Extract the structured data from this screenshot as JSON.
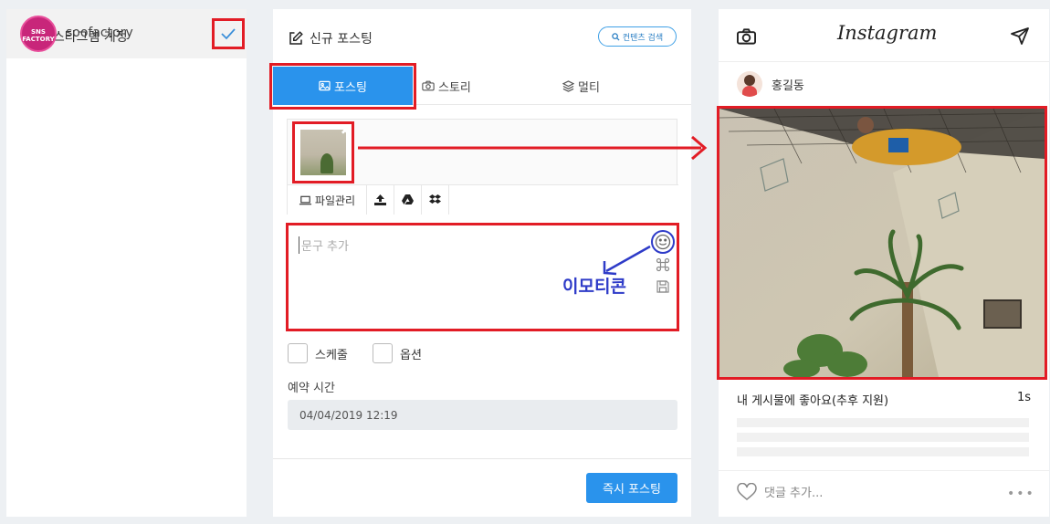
{
  "accounts_panel": {
    "title": "인스타그램 계정",
    "accounts": [
      {
        "name": "soofactory",
        "logo_text_top": "SNS",
        "logo_text_bottom": "FACTORY",
        "selected": true
      }
    ]
  },
  "compose_panel": {
    "title": "신규 포스팅",
    "search_button": "컨텐츠 검색",
    "tabs": [
      {
        "label": "포스팅",
        "icon": "image-icon",
        "active": true
      },
      {
        "label": "스토리",
        "icon": "camera-icon",
        "active": false
      },
      {
        "label": "멀티",
        "icon": "layers-icon",
        "active": false
      }
    ],
    "media_toolbar": {
      "file_manager_label": "파일관리",
      "buttons": [
        "upload-icon",
        "google-drive-icon",
        "dropbox-icon"
      ]
    },
    "caption": {
      "placeholder": "문구 추가",
      "value": ""
    },
    "emoticon_annotation": "이모티콘",
    "options": [
      {
        "label": "스케줄",
        "checked": false
      },
      {
        "label": "옵션",
        "checked": false
      }
    ],
    "schedule": {
      "label": "예약 시간",
      "value": "04/04/2019 12:19"
    },
    "post_button": "즉시 포스팅"
  },
  "preview_panel": {
    "brand": "Instagram",
    "username": "홍길동",
    "likes_text": "내 게시물에 좋아요(추후 지원)",
    "time_ago": "1s",
    "comment_placeholder": "댓글 추가...",
    "more_label": "•••"
  },
  "colors": {
    "accent_blue": "#2a93ec",
    "highlight_red": "#e21c25",
    "annotation_indigo": "#2e3bc8"
  }
}
